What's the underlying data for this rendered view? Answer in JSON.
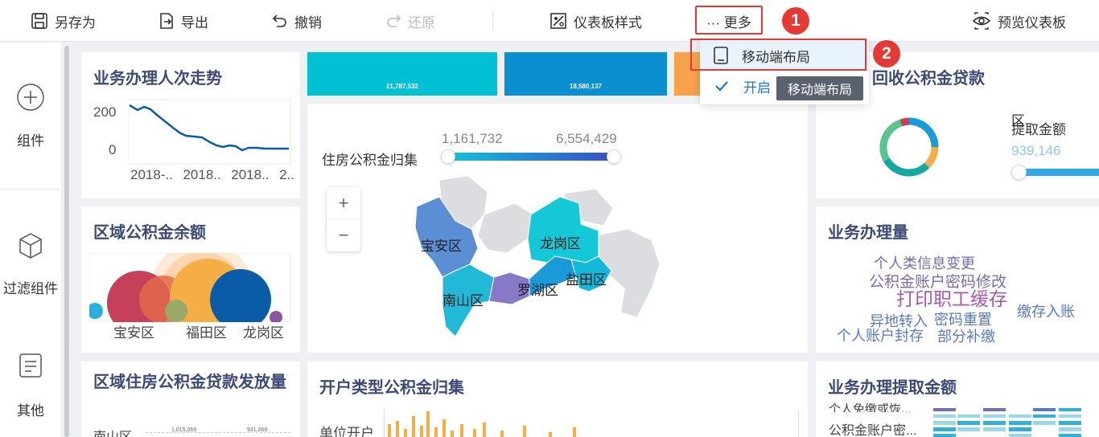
{
  "toolbar": {
    "save_as": "另存为",
    "export": "导出",
    "undo": "撤销",
    "redo": "还原",
    "dashboard_style": "仪表板样式",
    "more": "··· 更多",
    "preview": "预览仪表板"
  },
  "badges": {
    "first": "1",
    "second": "2"
  },
  "sidebar": {
    "items": [
      {
        "label": "组件",
        "icon": "plus-circle-icon"
      },
      {
        "label": "过滤组件",
        "icon": "cube-icon"
      },
      {
        "label": "其他",
        "icon": "note-icon"
      }
    ]
  },
  "dropdown": {
    "mobile_layout": "移动端布局",
    "enable": "开启",
    "tooltip": "移动端布局"
  },
  "cards": {
    "trend": {
      "title": "业务办理人次走势",
      "yticks": [
        "200",
        "0"
      ],
      "xticks": [
        "2018-..",
        "2018..",
        "2018..",
        "2.."
      ]
    },
    "region_balance": {
      "title": "区域公积金余额",
      "labels": [
        "宝安区",
        "福田区",
        "龙岗区"
      ]
    },
    "loan_release": {
      "title": "区域住房公积金贷款发放量",
      "row_label": "南山区",
      "values": [
        "1,015,069",
        "931,068"
      ]
    },
    "kpi": {
      "tile1": "21,787,532",
      "tile2": "18,580,137"
    },
    "map": {
      "legend_title": "住房公积金归集",
      "range_min": "1,161,732",
      "range_max": "6,554,429",
      "zoom_in": "+",
      "zoom_out": "−",
      "districts": [
        "宝安区",
        "龙岗区",
        "南山区",
        "罗湖区",
        "盐田区"
      ]
    },
    "account_type": {
      "title": "开户类型公积金归集",
      "row_label": "单位开户"
    },
    "loan_recover": {
      "title_tail": "回收公积金贷款",
      "legend_fragment": "区",
      "legend_title": "提取金额",
      "slider_value": "939,146"
    },
    "volume": {
      "title": "业务办理量",
      "words": [
        "个人类信息变更",
        "公积金账户密码修改",
        "打印职工缓存",
        "缴存入账",
        "异地转入",
        "密码重置",
        "个人账户封存",
        "部分补缴"
      ]
    },
    "withdraw": {
      "title": "业务办理提取金额",
      "rows": [
        "个人免缴或恢...",
        "公积金账户密..."
      ]
    }
  },
  "colors": {
    "title": "#3d4a77",
    "accent_blue": "#1a73e8",
    "highlight_red": "#e53935",
    "tile_teal": "#00c0d4",
    "tile_blue": "#0a8fd1",
    "tile_orange": "#f7a24b"
  }
}
